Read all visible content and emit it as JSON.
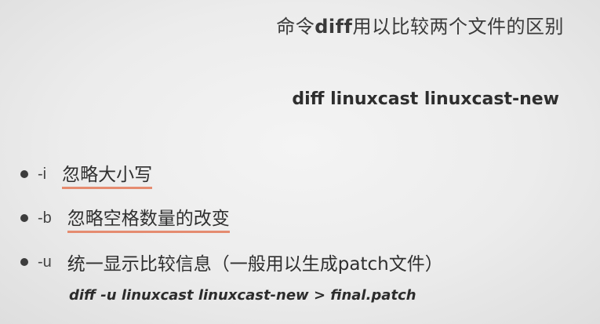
{
  "title": {
    "prefix": "命令",
    "command": "diff",
    "suffix": "用以比较两个文件的区别"
  },
  "command_heading": "diff linuxcast  linuxcast-new",
  "options": [
    {
      "flag": "-i",
      "description": "忽略大小写",
      "underlined": true
    },
    {
      "flag": "-b",
      "description": "忽略空格数量的改变",
      "underlined": true
    },
    {
      "flag": "-u",
      "description": "统一显示比较信息（一般用以生成patch文件）",
      "underlined": false
    }
  ],
  "example": "diff -u linuxcast linuxcast-new  > final.patch",
  "colors": {
    "underline": "#e58c70",
    "text": "#333333"
  }
}
